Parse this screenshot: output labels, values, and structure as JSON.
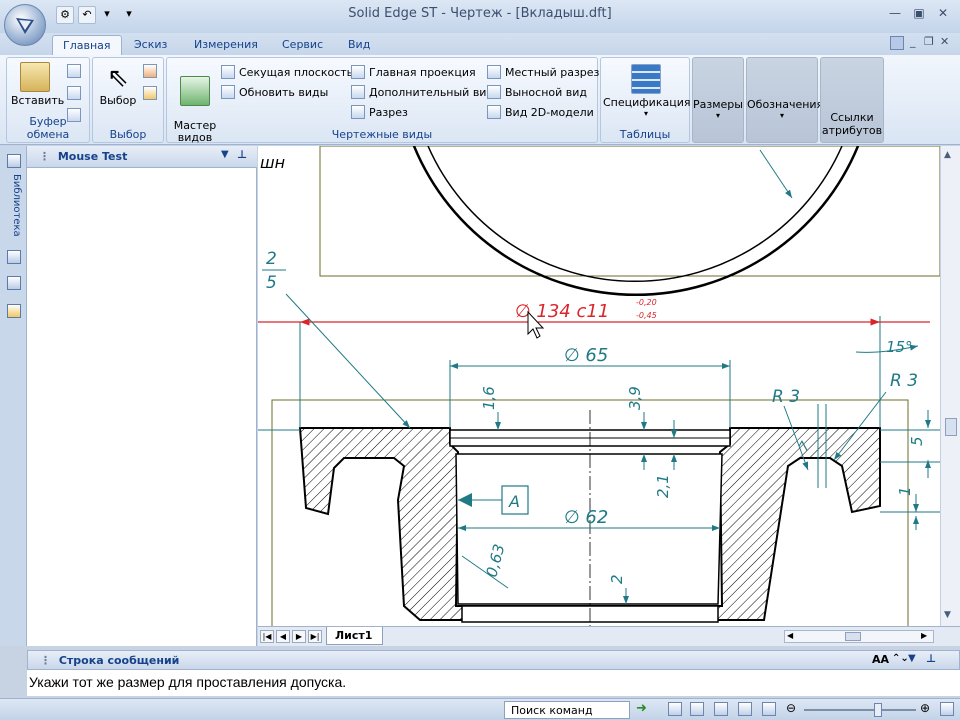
{
  "window": {
    "title": "Solid Edge ST - Чертеж - [Вкладыш.dft]"
  },
  "tabs": [
    "Главная",
    "Эскиз",
    "Измерения",
    "Сервис",
    "Вид"
  ],
  "ribbon": {
    "clipboard": {
      "paste": "Вставить",
      "label": "Буфер обмена"
    },
    "select": {
      "button": "Выбор",
      "label": "Выбор"
    },
    "views": {
      "wizard": "Мастер\nвидов",
      "items": [
        "Секущая плоскость",
        "Обновить виды",
        "Главная проекция",
        "Дополнительный вид",
        "Разрез",
        "Местный разрез",
        "Выносной вид",
        "Вид 2D-модели"
      ],
      "label": "Чертежные виды"
    },
    "tables": {
      "spec": "Спецификация",
      "label": "Таблицы"
    },
    "dims": "Размеры",
    "annot": "Обозначения",
    "attr_links": "Ссылки\nатрибутов"
  },
  "side_tab": "Библиотека",
  "panel": {
    "title": "Mouse Test"
  },
  "drawing": {
    "title_fragment": "шн",
    "balloon_top": "2",
    "balloon_bottom": "5",
    "dim_main": "∅ 134 c11",
    "tol_upper": "-0,20",
    "tol_lower": "-0,45",
    "dim_65": "∅ 65",
    "dim_62": "∅ 62",
    "dim_1_6": "1,6",
    "dim_3_9": "3,9",
    "dim_2_1": "2,1",
    "dim_0_63": "0,63",
    "dim_2": "2",
    "dim_r3_left": "R 3",
    "dim_r3_right": "R 3",
    "dim_15deg": "15°",
    "dim_5": "5",
    "dim_1": "1",
    "dim_7": "7",
    "datum": "A"
  },
  "sheet": {
    "tab": "Лист1"
  },
  "messages": {
    "title": "Строка сообщений",
    "text": "Укажи тот же размер для проставления допуска."
  },
  "status": {
    "search": "Поиск команд"
  },
  "colors": {
    "dim_green": "#1f7a86",
    "selected_red": "#d8262b"
  }
}
